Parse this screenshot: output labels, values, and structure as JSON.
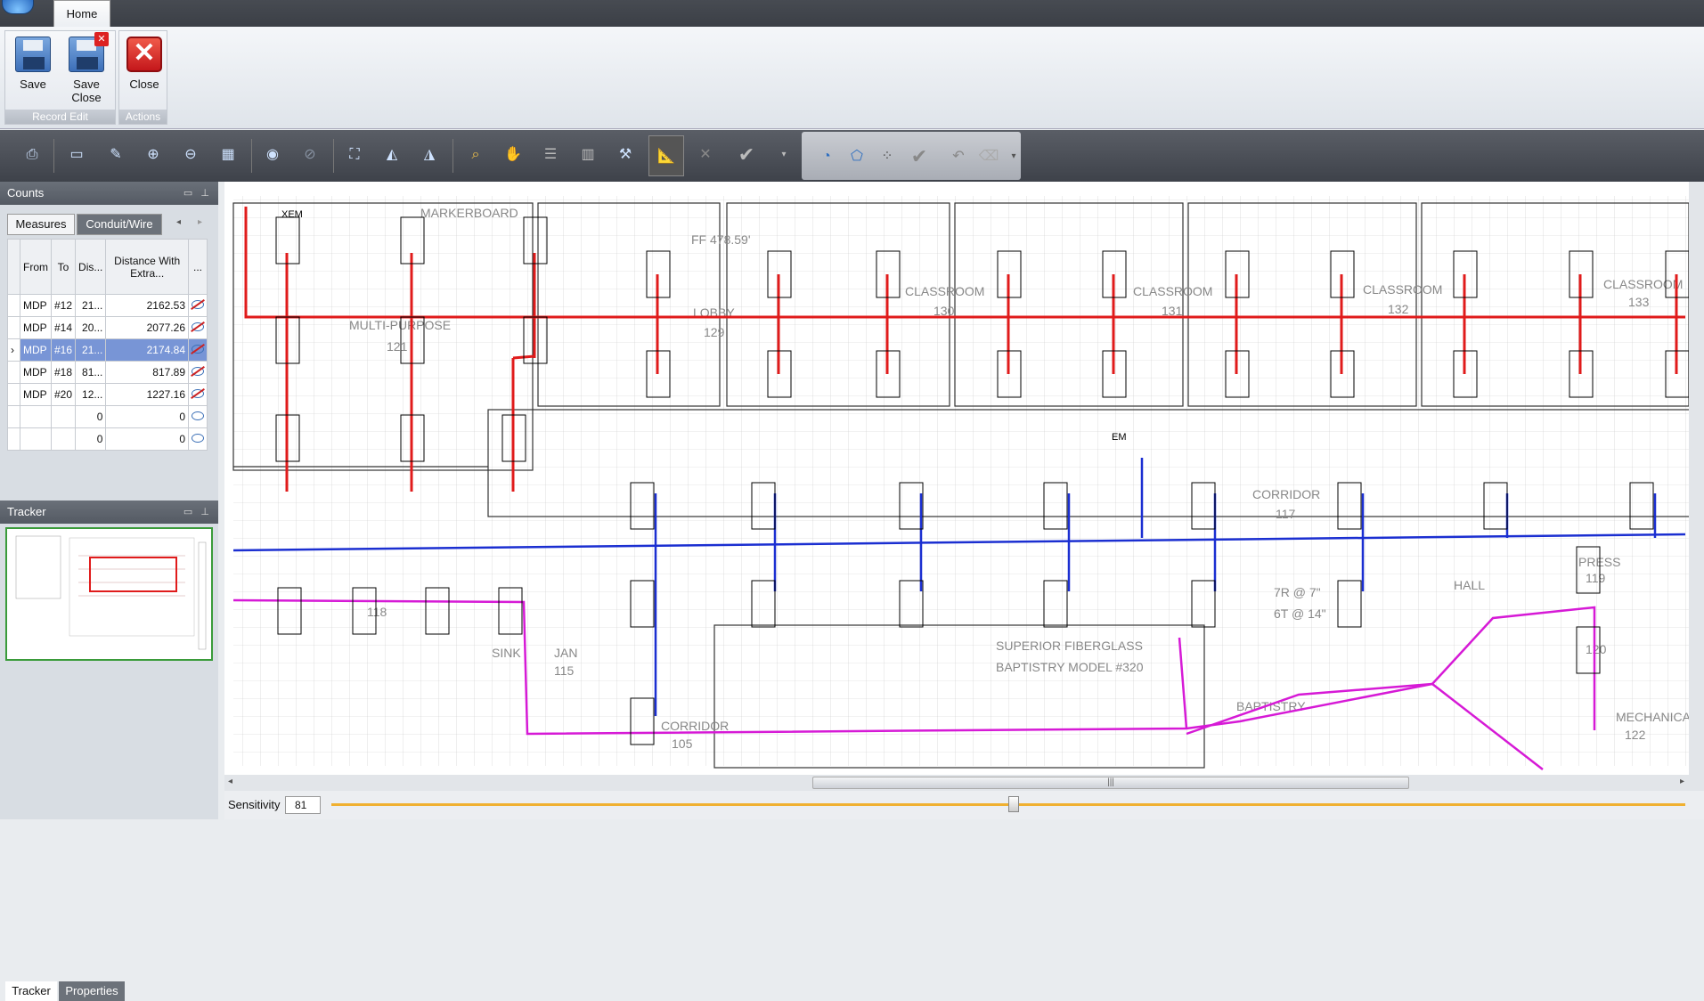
{
  "titlebar": {
    "tab": "Home"
  },
  "ribbon": {
    "groups": [
      {
        "label": "Record Edit",
        "buttons": [
          {
            "label": "Save",
            "icon": "save-icon"
          },
          {
            "label": "Save Close",
            "icon": "save-close-icon"
          }
        ]
      },
      {
        "label": "Actions",
        "buttons": [
          {
            "label": "Close",
            "icon": "close-icon"
          }
        ]
      }
    ]
  },
  "toolbar": {
    "icons": [
      "print-icon",
      "page-icon",
      "edit-icon",
      "add-page-icon",
      "delete-page-icon",
      "grid-icon",
      "eye-icon",
      "eye-off-icon",
      "zoom-fit-icon",
      "flip-icon",
      "mirror-icon",
      "zoom-icon",
      "pan-icon",
      "list-icon",
      "table-icon",
      "tools-icon",
      "ruler-icon",
      "cancel-icon",
      "check-icon",
      "dropdown-icon"
    ],
    "secondary_icons": [
      "shapes-icon",
      "polygon-icon",
      "group-icon",
      "check-icon",
      "undo-icon",
      "eraser-icon",
      "dropdown-icon"
    ]
  },
  "counts": {
    "title": "Counts",
    "tabs": [
      "Measures",
      "Conduit/Wire"
    ],
    "active_tab": "Conduit/Wire",
    "columns": [
      "From",
      "To",
      "Dis...",
      "Distance With Extra...",
      "..."
    ],
    "rows": [
      {
        "from": "MDP",
        "to": "#12",
        "dis": "21...",
        "extra": "2162.53",
        "visible": false
      },
      {
        "from": "MDP",
        "to": "#14",
        "dis": "20...",
        "extra": "2077.26",
        "visible": false
      },
      {
        "from": "MDP",
        "to": "#16",
        "dis": "21...",
        "extra": "2174.84",
        "visible": false,
        "selected": true
      },
      {
        "from": "MDP",
        "to": "#18",
        "dis": "81...",
        "extra": "817.89",
        "visible": false
      },
      {
        "from": "MDP",
        "to": "#20",
        "dis": "12...",
        "extra": "1227.16",
        "visible": false
      },
      {
        "from": "",
        "to": "",
        "dis": "0",
        "extra": "0",
        "visible": true
      },
      {
        "from": "",
        "to": "",
        "dis": "0",
        "extra": "0",
        "visible": true
      }
    ]
  },
  "tracker": {
    "title": "Tracker"
  },
  "bottom_tabs": [
    "Tracker",
    "Properties"
  ],
  "sensitivity": {
    "label": "Sensitivity",
    "value": "81"
  },
  "drawing": {
    "labels": [
      "MULTI-PURPOSE",
      "121",
      "LOBBY",
      "129",
      "FF 478.59'",
      "CLASSROOM",
      "130",
      "CLASSROOM",
      "131",
      "CLASSROOM",
      "132",
      "CLASSROOM",
      "133",
      "CORRIDOR",
      "117",
      "SUPERIOR FIBERGLASS",
      "BAPTISTRY MODEL #320",
      "CORRIDOR",
      "105",
      "JAN",
      "115",
      "MECHANICAL",
      "122",
      "MARKERBOARD",
      "SINK",
      "118",
      "XEM",
      "EM",
      "BAPTISTRY",
      "HALL",
      "PRESS",
      "119",
      "120",
      "7R @ 7\"",
      "6T @ 14\""
    ]
  }
}
